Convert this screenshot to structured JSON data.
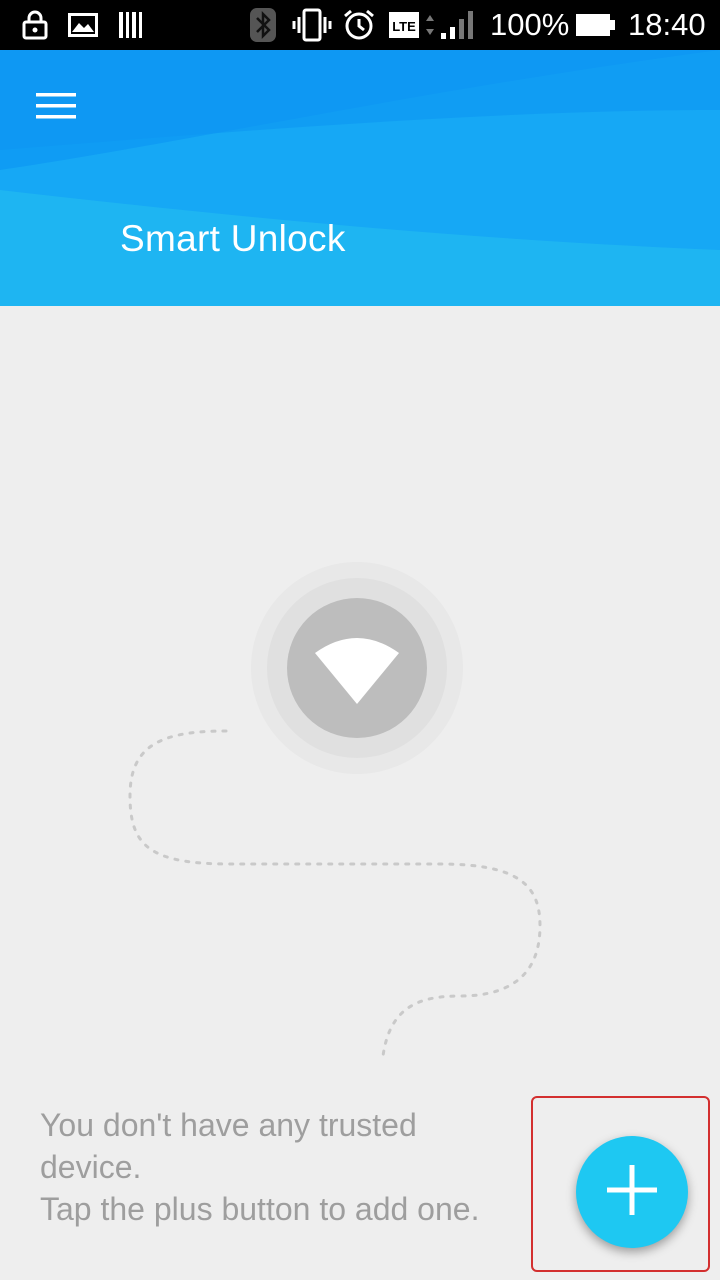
{
  "status_bar": {
    "battery_percent": "100%",
    "time": "18:40",
    "network_label": "LTE",
    "icons": [
      "lock-icon",
      "image-icon",
      "barcode-icon",
      "bluetooth-icon",
      "vibrate-icon",
      "alarm-icon",
      "lte-icon",
      "signal-icon",
      "battery-icon"
    ]
  },
  "header": {
    "title": "Smart Unlock",
    "menu_icon": "hamburger-menu-icon",
    "color": "#14a0f0"
  },
  "illustration": {
    "icon": "wifi-icon"
  },
  "empty_state": {
    "line1": "You don't have any trusted",
    "line2": "device.",
    "line3": "Tap the plus button to add one."
  },
  "fab": {
    "icon": "plus-icon",
    "color": "#1ec8f2"
  }
}
